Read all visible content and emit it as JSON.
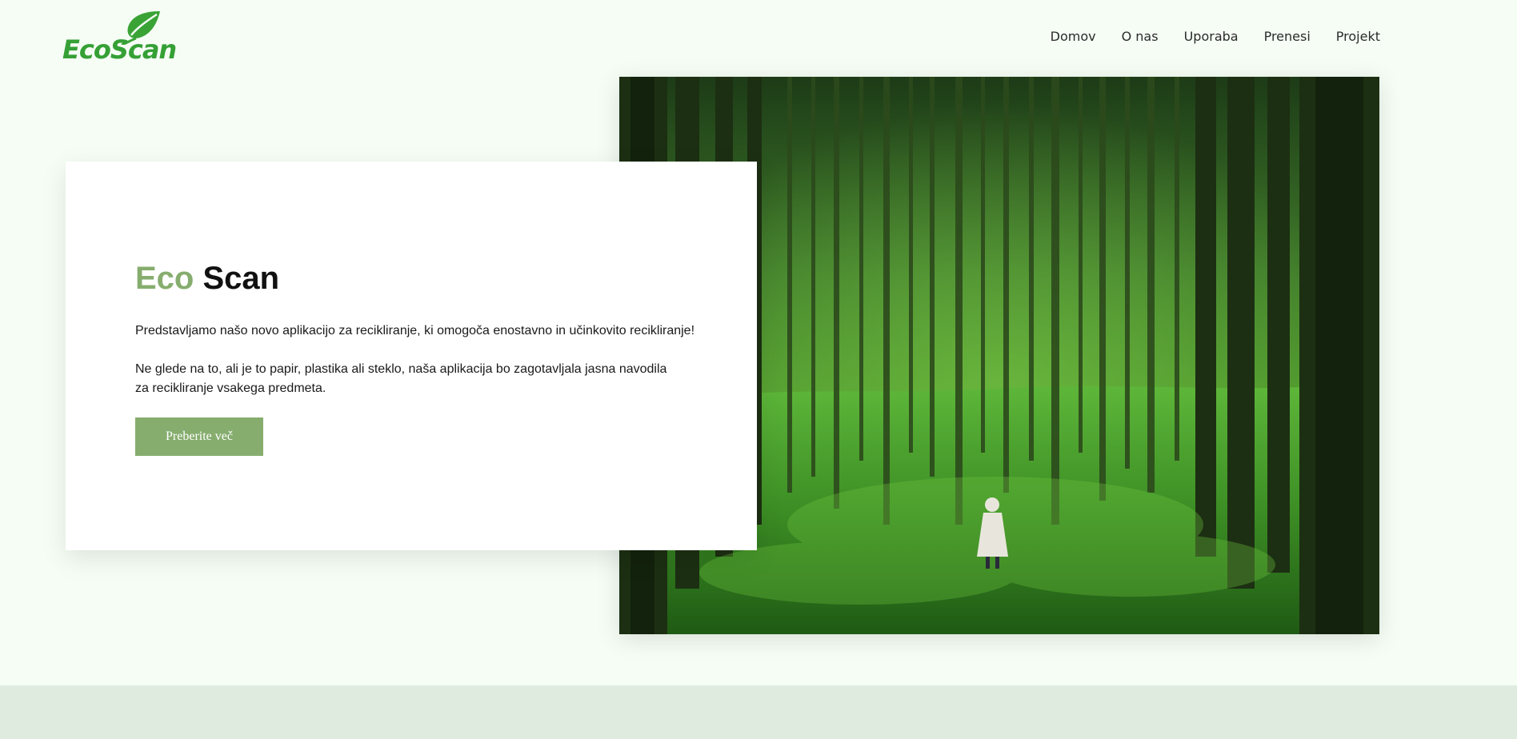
{
  "logo": {
    "text": "EcoScan",
    "icon": "leaf-icon",
    "color": "#35a035"
  },
  "nav": {
    "items": [
      "Domov",
      "O nas",
      "Uporaba",
      "Prenesi",
      "Projekt"
    ]
  },
  "hero": {
    "title_accent": "Eco",
    "title_rest": "Scan",
    "paragraph_1": "Predstavljamo našo novo aplikacijo za recikliranje, ki omogoča enostavno in učinkovito recikliranje!",
    "paragraph_2": "Ne glede na to, ali je to papir, plastika ali steklo, naša aplikacija bo zagotavljala jasna navodila za recikliranje vsakega predmeta.",
    "button_label": "Preberite več",
    "accent_color": "#86ad6e"
  },
  "colors": {
    "page_background": "#f5fdf5",
    "footer_band": "#e0ebe0"
  }
}
